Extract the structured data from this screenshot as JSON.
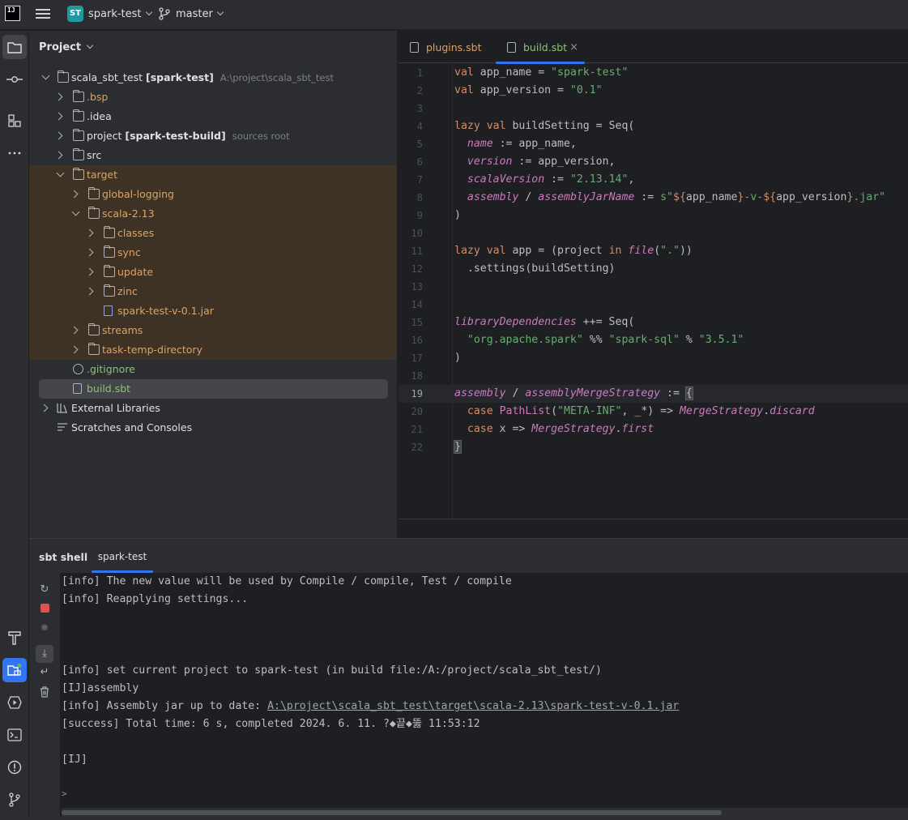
{
  "titlebar": {
    "logo": "IJ",
    "project_badge": "ST",
    "project_name": "spark-test",
    "branch": "master"
  },
  "project_panel": {
    "title": "Project",
    "tree": [
      {
        "label": "scala_sbt_test",
        "bold_suffix": "[spark-test]",
        "hint": "A:\\project\\scala_sbt_test"
      },
      {
        "label": ".bsp"
      },
      {
        "label": ".idea"
      },
      {
        "label": "project",
        "bold_suffix": "[spark-test-build]",
        "hint": "sources root"
      },
      {
        "label": "src"
      },
      {
        "label": "target"
      },
      {
        "label": "global-logging"
      },
      {
        "label": "scala-2.13"
      },
      {
        "label": "classes"
      },
      {
        "label": "sync"
      },
      {
        "label": "update"
      },
      {
        "label": "zinc"
      },
      {
        "label": "spark-test-v-0.1.jar"
      },
      {
        "label": "streams"
      },
      {
        "label": "task-temp-directory"
      },
      {
        "label": ".gitignore"
      },
      {
        "label": "build.sbt"
      },
      {
        "label": "External Libraries"
      },
      {
        "label": "Scratches and Consoles"
      }
    ]
  },
  "editor": {
    "tabs": [
      {
        "label": "plugins.sbt"
      },
      {
        "label": "build.sbt",
        "close": "×"
      }
    ],
    "line_numbers": [
      "1",
      "2",
      "3",
      "4",
      "5",
      "6",
      "7",
      "8",
      "9",
      "10",
      "11",
      "12",
      "13",
      "14",
      "15",
      "16",
      "17",
      "18",
      "19",
      "20",
      "21",
      "22"
    ],
    "code": {
      "l1": [
        "val",
        " app_name = ",
        "\"spark-test\""
      ],
      "l2": [
        "val",
        " app_version = ",
        "\"0.1\""
      ],
      "l4": [
        "lazy val",
        " buildSetting = Seq("
      ],
      "l5": [
        "  ",
        "name",
        " := app_name,"
      ],
      "l6": [
        "  ",
        "version",
        " := app_version,"
      ],
      "l7": [
        "  ",
        "scalaVersion",
        " := ",
        "\"2.13.14\"",
        ","
      ],
      "l8": [
        "  ",
        "assembly",
        " / ",
        "assemblyJarName",
        " := ",
        "s\"",
        "${",
        "app_name",
        "}",
        "-v-",
        "${",
        "app_version",
        "}",
        ".jar\""
      ],
      "l9": [
        ")"
      ],
      "l11": [
        "lazy val",
        " app = (project ",
        "in",
        " ",
        "file",
        "(",
        "\".\"",
        "))"
      ],
      "l12": [
        "  .settings(buildSetting)"
      ],
      "l15": [
        "libraryDependencies",
        " ++= Seq("
      ],
      "l16": [
        "  ",
        "\"org.apache.spark\"",
        " %% ",
        "\"spark-sql\"",
        " % ",
        "\"3.5.1\""
      ],
      "l17": [
        ")"
      ],
      "l19": [
        "assembly",
        " / ",
        "assemblyMergeStrategy",
        " := ",
        "{"
      ],
      "l20": [
        "  ",
        "case",
        " ",
        "PathList",
        "(",
        "\"META-INF\"",
        ", _*) => ",
        "MergeStrategy",
        ".",
        "discard"
      ],
      "l21": [
        "  ",
        "case",
        " x => ",
        "MergeStrategy",
        ".",
        "first"
      ],
      "l22": [
        "}"
      ]
    }
  },
  "shell": {
    "title": "sbt shell",
    "tab": "spark-test",
    "lines": [
      "[info] The new value will be used by Compile / compile, Test / compile",
      "[info] Reapplying settings...",
      "[info] set current project to spark-test (in build file:/A:/project/scala_sbt_test/)",
      "[IJ]assembly",
      "[info] Assembly jar up to date: ",
      "[success] Total time: 6 s, completed 2024. 6. 11. ?◆끝◆뚫 11:53:12",
      "[IJ]",
      ">"
    ],
    "jar_path": "A:\\project\\scala_sbt_test\\target\\scala-2.13\\spark-test-v-0.1.jar"
  }
}
